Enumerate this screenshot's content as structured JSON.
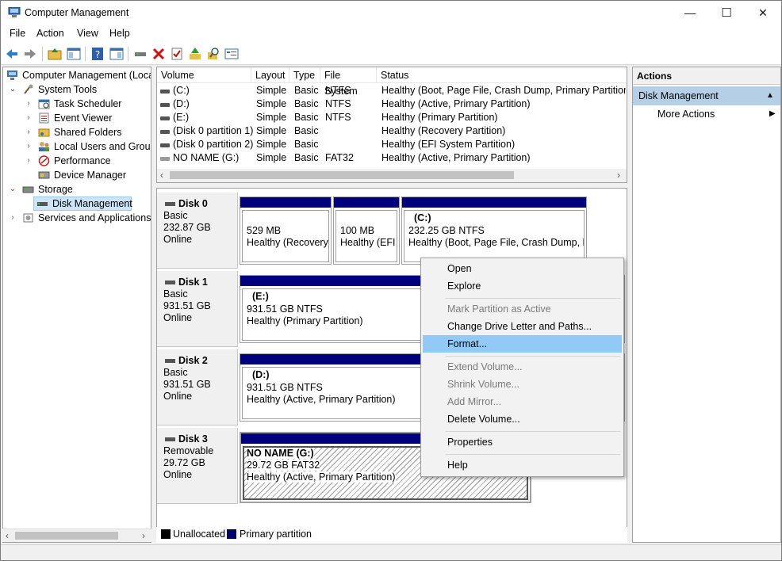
{
  "window": {
    "title": "Computer Management",
    "controls": {
      "minimize": "—",
      "maximize": "☐",
      "close": "✕"
    }
  },
  "menu": [
    "File",
    "Action",
    "View",
    "Help"
  ],
  "toolbar_icons": [
    "back-icon",
    "forward-icon",
    "up-folder-icon",
    "show-hide-tree-icon",
    "help-icon",
    "show-pane-icon",
    "connect-icon",
    "delete-icon",
    "check-icon",
    "up-arrow-icon",
    "search-icon",
    "properties-icon"
  ],
  "tree": {
    "root": "Computer Management (Local",
    "system_tools": "System Tools",
    "task_scheduler": "Task Scheduler",
    "event_viewer": "Event Viewer",
    "shared_folders": "Shared Folders",
    "local_users": "Local Users and Groups",
    "performance": "Performance",
    "device_manager": "Device Manager",
    "storage": "Storage",
    "disk_management": "Disk Management",
    "services": "Services and Applications"
  },
  "volumes": {
    "headers": [
      "Volume",
      "Layout",
      "Type",
      "File System",
      "Status"
    ],
    "rows": [
      [
        "(C:)",
        "Simple",
        "Basic",
        "NTFS",
        "Healthy (Boot, Page File, Crash Dump, Primary Partition)"
      ],
      [
        "(D:)",
        "Simple",
        "Basic",
        "NTFS",
        "Healthy (Active, Primary Partition)"
      ],
      [
        "(E:)",
        "Simple",
        "Basic",
        "NTFS",
        "Healthy (Primary Partition)"
      ],
      [
        "(Disk 0 partition 1)",
        "Simple",
        "Basic",
        "",
        "Healthy (Recovery Partition)"
      ],
      [
        "(Disk 0 partition 2)",
        "Simple",
        "Basic",
        "",
        "Healthy (EFI System Partition)"
      ],
      [
        "NO NAME (G:)",
        "Simple",
        "Basic",
        "FAT32",
        "Healthy (Active, Primary Partition)"
      ]
    ]
  },
  "disks": [
    {
      "name": "Disk 0",
      "type": "Basic",
      "size": "232.87 GB",
      "status": "Online",
      "partitions": [
        {
          "label": "",
          "size": "529 MB",
          "status": "Healthy (Recovery F"
        },
        {
          "label": "",
          "size": "100 MB",
          "status": "Healthy (EFI S"
        },
        {
          "label": "(C:)",
          "size": "232.25 GB NTFS",
          "status": "Healthy (Boot, Page File, Crash Dump, Pri"
        }
      ]
    },
    {
      "name": "Disk 1",
      "type": "Basic",
      "size": "931.51 GB",
      "status": "Online",
      "partitions": [
        {
          "label": "(E:)",
          "size": "931.51 GB NTFS",
          "status": "Healthy (Primary Partition)"
        }
      ]
    },
    {
      "name": "Disk 2",
      "type": "Basic",
      "size": "931.51 GB",
      "status": "Online",
      "partitions": [
        {
          "label": "(D:)",
          "size": "931.51 GB NTFS",
          "status": "Healthy (Active, Primary Partition)"
        }
      ]
    },
    {
      "name": "Disk 3",
      "type": "Removable",
      "size": "29.72 GB",
      "status": "Online",
      "partitions": [
        {
          "label": "NO NAME  (G:)",
          "size": "29.72 GB FAT32",
          "status": "Healthy (Active, Primary Partition)"
        }
      ]
    }
  ],
  "legend": {
    "unallocated": "Unallocated",
    "primary": "Primary partition"
  },
  "actions": {
    "header": "Actions",
    "section": "Disk Management",
    "more": "More Actions"
  },
  "context_menu": {
    "open": "Open",
    "explore": "Explore",
    "mark_active": "Mark Partition as Active",
    "change_letter": "Change Drive Letter and Paths...",
    "format": "Format...",
    "extend": "Extend Volume...",
    "shrink": "Shrink Volume...",
    "add_mirror": "Add Mirror...",
    "delete": "Delete Volume...",
    "properties": "Properties",
    "help": "Help"
  },
  "colors": {
    "primary_partition": "#00007f",
    "selection": "#cce4f7",
    "menu_highlight": "#91c9f7",
    "actions_section": "#b4cfe6"
  }
}
